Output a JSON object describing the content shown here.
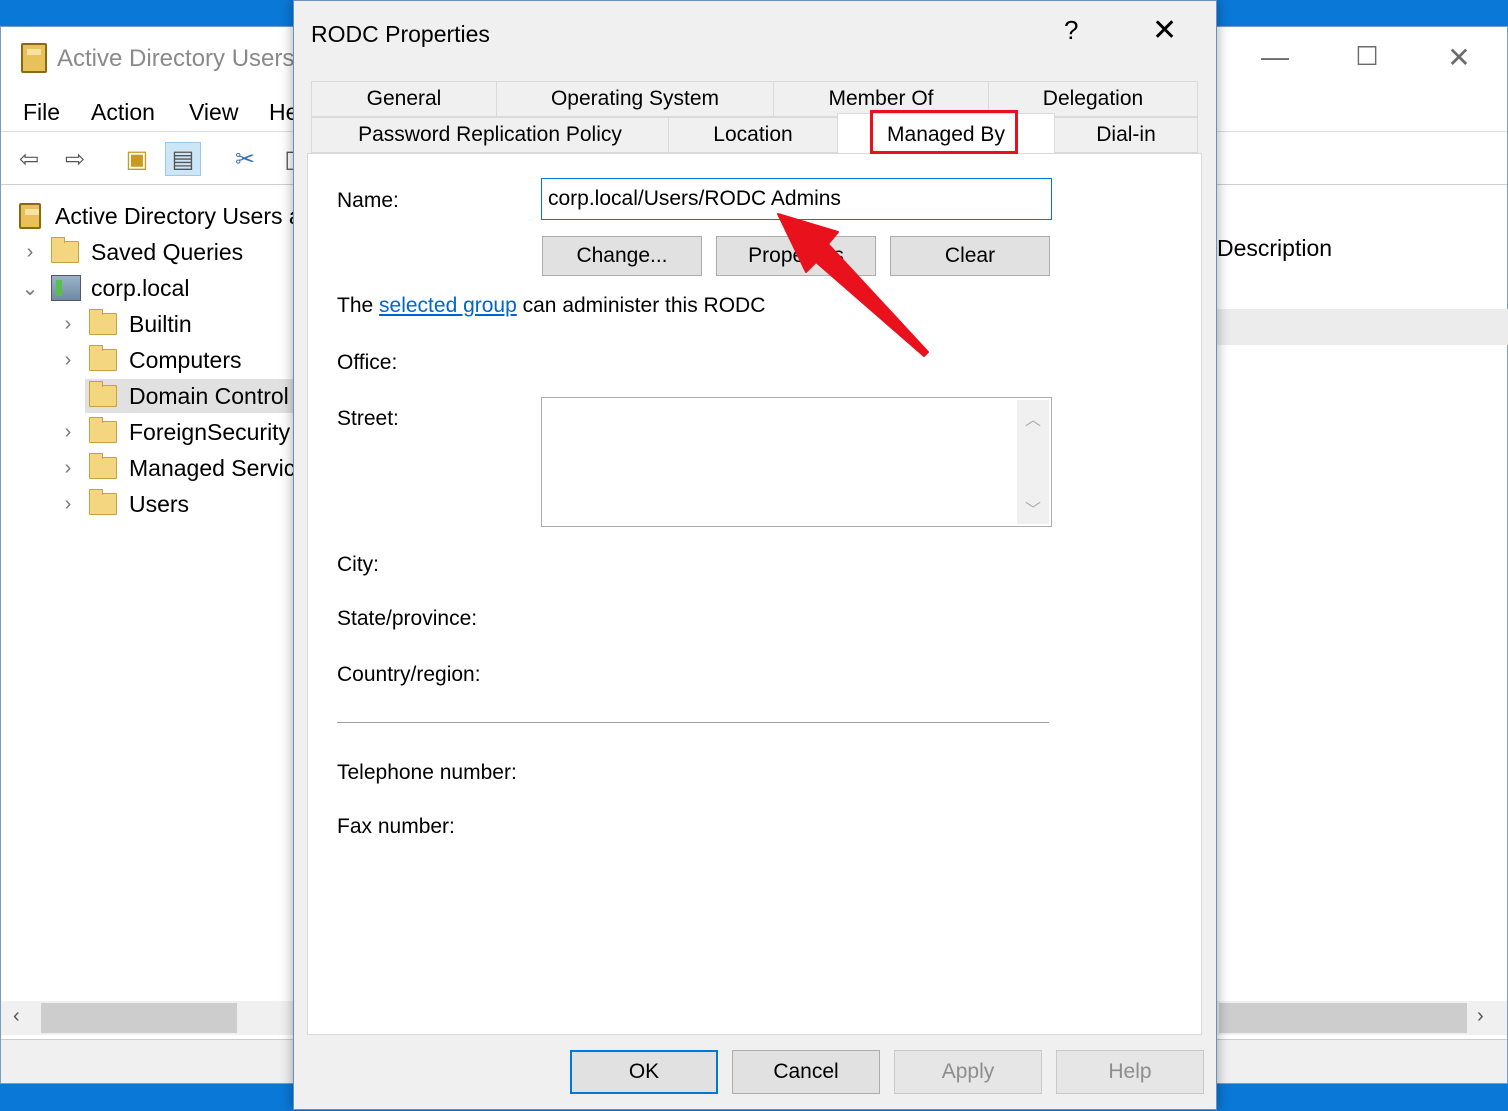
{
  "background_window": {
    "title": "Active Directory Users",
    "menu": [
      "File",
      "Action",
      "View",
      "He"
    ],
    "tree": [
      {
        "label": "Active Directory Users a",
        "level": 0,
        "icon": "aduc-icon"
      },
      {
        "label": "Saved Queries",
        "level": 1,
        "icon": "folder-icon",
        "expander": ">"
      },
      {
        "label": "corp.local",
        "level": 1,
        "icon": "domain-icon",
        "expander": "v"
      },
      {
        "label": "Builtin",
        "level": 2,
        "icon": "folder-icon",
        "expander": ">"
      },
      {
        "label": "Computers",
        "level": 2,
        "icon": "folder-icon",
        "expander": ">"
      },
      {
        "label": "Domain Control",
        "level": 2,
        "icon": "ou-icon",
        "selected": true
      },
      {
        "label": "ForeignSecurity",
        "level": 2,
        "icon": "folder-icon",
        "expander": ">"
      },
      {
        "label": "Managed Servic",
        "level": 2,
        "icon": "folder-icon",
        "expander": ">"
      },
      {
        "label": "Users",
        "level": 2,
        "icon": "folder-icon",
        "expander": ">"
      }
    ],
    "description_header": "Description"
  },
  "dialog": {
    "title": "RODC Properties",
    "help_glyph": "?",
    "close_glyph": "✕",
    "tabs_row1": [
      "General",
      "Operating System",
      "Member Of",
      "Delegation"
    ],
    "tabs_row2": [
      "Password Replication Policy",
      "Location",
      "Managed By",
      "Dial-in"
    ],
    "active_tab": "Managed By",
    "name_label": "Name:",
    "name_value": "corp.local/Users/RODC Admins",
    "buttons": {
      "change": "Change...",
      "properties": "Properties",
      "clear": "Clear"
    },
    "info": {
      "prefix": "The ",
      "link": "selected group",
      "suffix": " can administer this RODC"
    },
    "fields": {
      "office": "Office:",
      "street": "Street:",
      "city": "City:",
      "state": "State/province:",
      "country": "Country/region:",
      "telephone": "Telephone number:",
      "fax": "Fax number:"
    },
    "footer": {
      "ok": "OK",
      "cancel": "Cancel",
      "apply": "Apply",
      "help": "Help"
    }
  },
  "annotation": {
    "highlight_color": "#e8111c"
  }
}
